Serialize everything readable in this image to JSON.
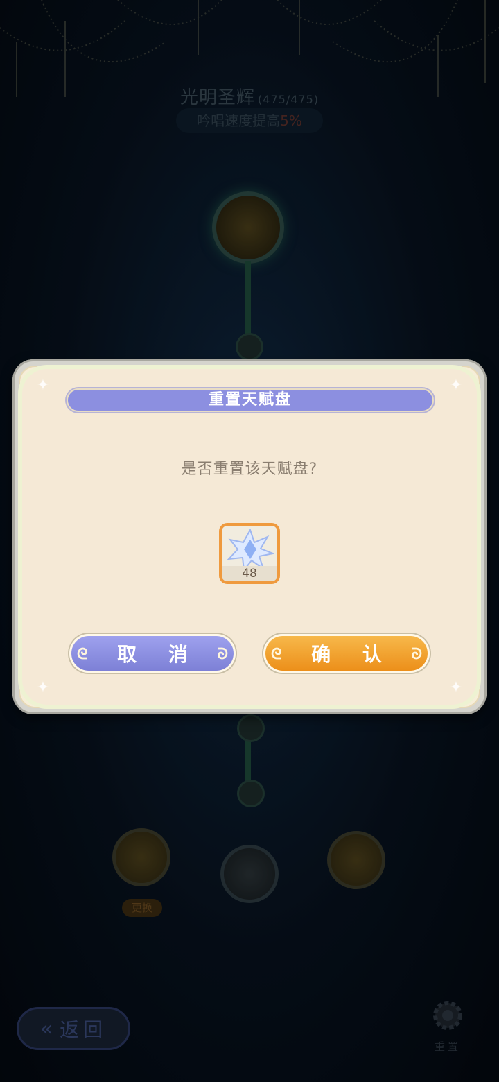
{
  "talent": {
    "name": "光明圣辉",
    "count": "(475/475)",
    "effect_prefix": "吟唱速度提高",
    "effect_value": "5%"
  },
  "bottom": {
    "swap_label": "更换",
    "back_label": "返回",
    "reset_label": "重置"
  },
  "dialog": {
    "title": "重置天赋盘",
    "question": "是否重置该天赋盘?",
    "item": {
      "icon": "crystal-star-icon",
      "count": "48"
    },
    "cancel_label": "取 消",
    "confirm_label": "确 认"
  },
  "colors": {
    "cancel": "#8c8fe0",
    "confirm": "#f0a030",
    "item_border": "#ef9a3e",
    "dialog_bg": "#f5e9d6"
  }
}
